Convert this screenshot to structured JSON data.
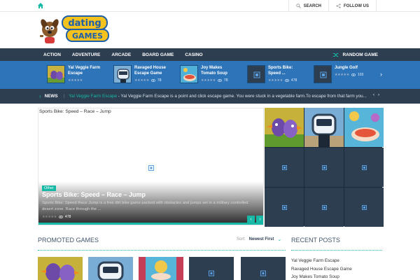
{
  "topbar": {
    "search_label": "SEARCH",
    "follow_label": "FOLLOW US"
  },
  "logo": {
    "text": "dating games"
  },
  "nav": {
    "items": [
      "ACTION",
      "ADVENTURE",
      "ARCADE",
      "BOARD GAME",
      "CASINO"
    ],
    "random_label": "RANDOM GAME"
  },
  "strip": {
    "items": [
      {
        "title": "Yal Veggie Farm Escape",
        "views": ""
      },
      {
        "title": "Ravaged House Escape Game",
        "views": "78"
      },
      {
        "title": "Joy Makes Tomato Soup",
        "views": "78"
      },
      {
        "title": "Sports Bike: Speed ...",
        "views": "478"
      },
      {
        "title": "Jungle Golf",
        "views": "103"
      }
    ]
  },
  "news": {
    "label": "NEWS",
    "headline": "Yal Veggie Farm Escape",
    "text": " - Yal Veggie Farm Escape is a point and click escape game. You were stuck in a vegetable farm.To escape from that farm you..."
  },
  "slider": {
    "title": "Sports Bike: Speed – Race – Jump",
    "category": "Other",
    "headline": "Sports Bike: Speed – Race – Jump",
    "description": "Sports Bike: Speed Race Jump is a free dirt bike game packed with obstacles and jumps set in a military controlled desert zone. Race through the ...",
    "views": "478"
  },
  "promoted": {
    "title": "PROMOTED GAMES",
    "sort_label": "Sort:",
    "sort_value": "Newest First"
  },
  "recent": {
    "title": "RECENT POSTS",
    "items": [
      "Yal Veggie Farm Escape",
      "Ravaged House Escape Game",
      "Joy Makes Tomato Soup"
    ]
  },
  "colors": {
    "nav_bg": "#2d3e50",
    "strip_bg": "#2e74b9",
    "accent": "#17b8a6"
  },
  "icons": {
    "home": "home-icon",
    "search": "search-icon",
    "share": "share-icon",
    "shuffle": "shuffle-icon",
    "eye": "eye-icon",
    "image_placeholder": "image-placeholder-icon"
  }
}
